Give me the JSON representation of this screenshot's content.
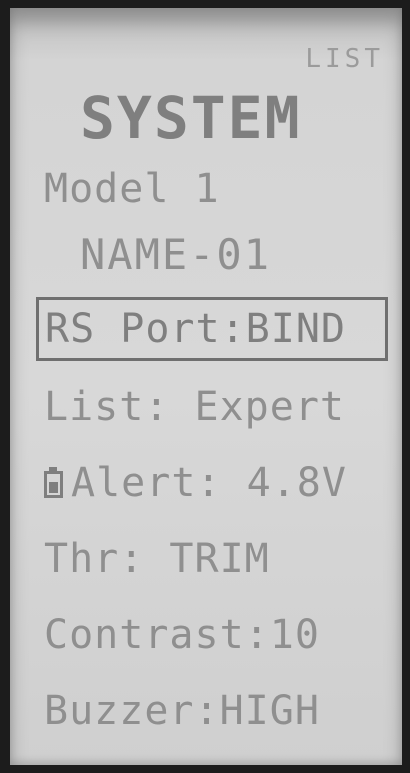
{
  "screen": {
    "list_tag": "LIST",
    "title": "SYSTEM",
    "model_label": "Model 1",
    "model_name": "NAME-01"
  },
  "menu": [
    {
      "label": "RS Port:BIND",
      "selected": true
    },
    {
      "label": "List: Expert",
      "selected": false
    },
    {
      "label": "Alert: 4.8V",
      "icon": "battery-icon",
      "selected": false
    },
    {
      "label": "Thr: TRIM",
      "selected": false
    },
    {
      "label": "Contrast:10",
      "selected": false
    },
    {
      "label": "Buzzer:HIGH",
      "selected": false
    }
  ],
  "colors": {
    "lcd_background": "#d4d4d4",
    "lcd_text": "#8f8f8f",
    "selection_border": "#6f6f6f"
  }
}
